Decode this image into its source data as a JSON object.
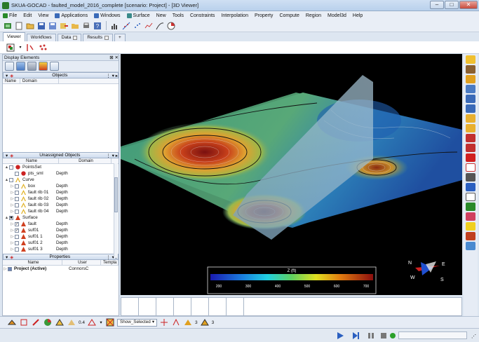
{
  "window": {
    "title": "SKUA-GOCAD - faulted_model_2016_complete  [scenario: Project]  - [3D Viewer]",
    "minimize": "–",
    "maximize": "□",
    "close": "✕"
  },
  "menu": [
    "File",
    "Edit",
    "View",
    "Applications",
    "Windows",
    "Surface",
    "New",
    "Tools",
    "Constraints",
    "Interpolation",
    "Property",
    "Compute",
    "Region",
    "Model3d",
    "Help"
  ],
  "tabs": [
    {
      "label": "Viewer"
    },
    {
      "label": "Workflows"
    },
    {
      "label": "Data"
    },
    {
      "label": "Results"
    },
    {
      "label": "+"
    }
  ],
  "display_elements": {
    "title": "Display Elements"
  },
  "objects": {
    "title": "Objects",
    "col_name": "Name",
    "col_domain": "Domain"
  },
  "unassigned": {
    "title": "Unassigned Objects",
    "col_name": "Name",
    "col_domain": "Domain",
    "rows": [
      {
        "name": "PointsSet",
        "domain": "",
        "level": 0,
        "expand": "▲",
        "check": "",
        "icon": "points"
      },
      {
        "name": "pts_sml",
        "domain": "Depth",
        "level": 1,
        "expand": "",
        "check": "",
        "icon": "points"
      },
      {
        "name": "Curve",
        "domain": "",
        "level": 0,
        "expand": "▲",
        "check": "",
        "icon": "curve"
      },
      {
        "name": "box",
        "domain": "Depth",
        "level": 1,
        "expand": "▷",
        "check": "",
        "icon": "curve"
      },
      {
        "name": "fault rib 01",
        "domain": "Depth",
        "level": 1,
        "expand": "▷",
        "check": "",
        "icon": "curve"
      },
      {
        "name": "fault rib 02",
        "domain": "Depth",
        "level": 1,
        "expand": "▷",
        "check": "",
        "icon": "curve"
      },
      {
        "name": "fault rib 03",
        "domain": "Depth",
        "level": 1,
        "expand": "▷",
        "check": "",
        "icon": "curve"
      },
      {
        "name": "fault rib 04",
        "domain": "Depth",
        "level": 1,
        "expand": "▷",
        "check": "",
        "icon": "curve"
      },
      {
        "name": "Surface",
        "domain": "",
        "level": 0,
        "expand": "▲",
        "check": "■",
        "icon": "surface"
      },
      {
        "name": "fault",
        "domain": "Depth",
        "level": 1,
        "expand": "▷",
        "check": "✓",
        "icon": "surface"
      },
      {
        "name": "suf01",
        "domain": "Depth",
        "level": 1,
        "expand": "▷",
        "check": "✓",
        "icon": "surface"
      },
      {
        "name": "suf01 1",
        "domain": "Depth",
        "level": 1,
        "expand": "▷",
        "check": "",
        "icon": "surface"
      },
      {
        "name": "suf01 2",
        "domain": "Depth",
        "level": 1,
        "expand": "▷",
        "check": "",
        "icon": "surface"
      },
      {
        "name": "suf01 3",
        "domain": "Depth",
        "level": 1,
        "expand": "▷",
        "check": "",
        "icon": "surface"
      }
    ]
  },
  "properties": {
    "title": "Properties",
    "col_name": "Name",
    "col_user": "User",
    "col_template": "Templa",
    "rows": [
      {
        "name": "Project (Active)",
        "user": "ConnorsC",
        "template": ""
      }
    ]
  },
  "colorbar": {
    "title": "Z (ft)",
    "ticks": [
      "200",
      "300",
      "400",
      "500",
      "600",
      "700"
    ]
  },
  "compass": {
    "n": "N",
    "e": "E",
    "s": "S",
    "w": "W"
  },
  "bottom_toolbar": {
    "value1": "0.4",
    "select": "Show_Selected",
    "value2": "3",
    "value3": "3"
  }
}
